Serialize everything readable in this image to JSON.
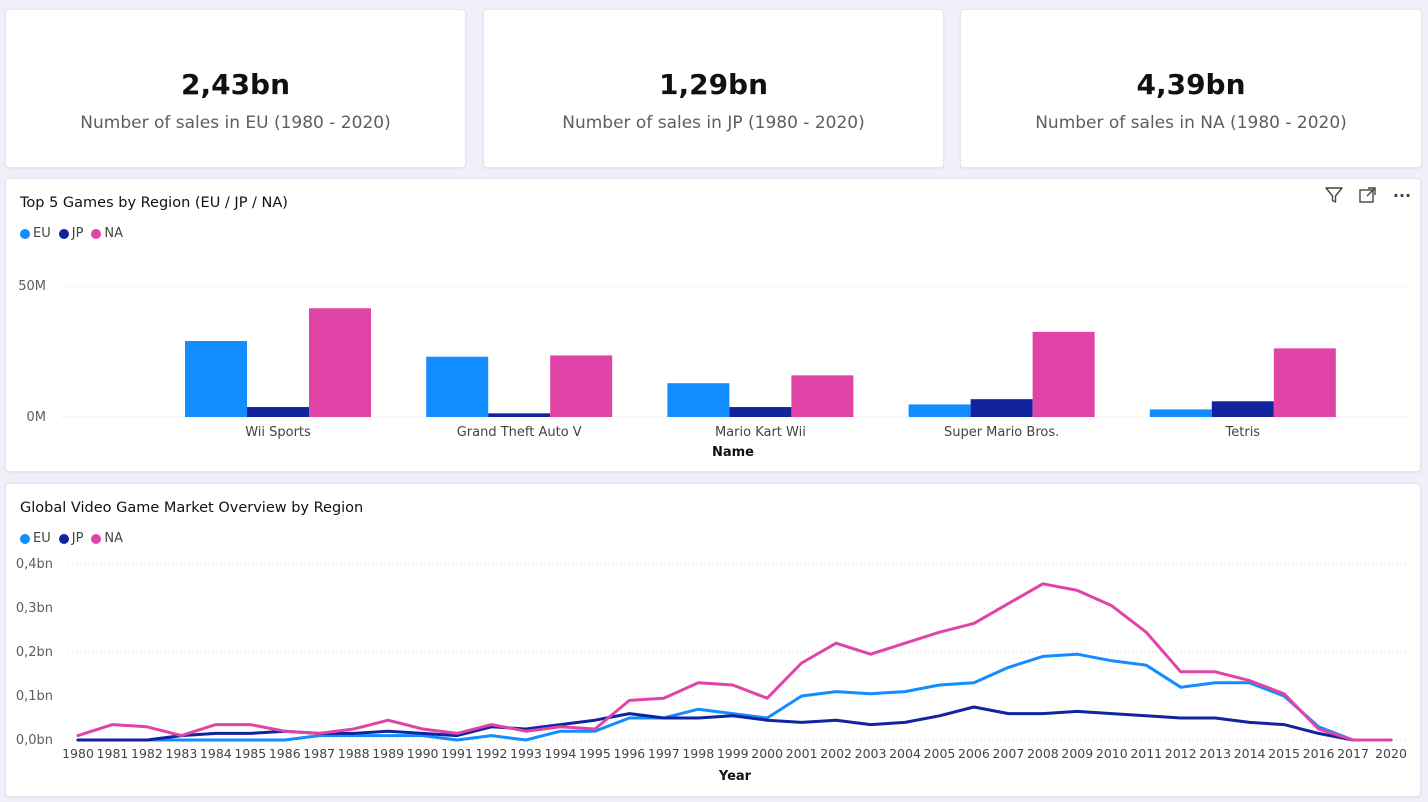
{
  "kpis": [
    {
      "value": "2,43bn",
      "label": "Number of sales in EU (1980 - 2020)"
    },
    {
      "value": "1,29bn",
      "label": "Number of sales in JP (1980 - 2020)"
    },
    {
      "value": "4,39bn",
      "label": "Number of sales in NA (1980 - 2020)"
    }
  ],
  "colors": {
    "EU": "#118dff",
    "JP": "#12239e",
    "NA": "#e044a7"
  },
  "toolbar": {
    "icons": [
      "filter-icon",
      "focus-mode-icon",
      "more-options-icon"
    ],
    "more_label": "···"
  },
  "chart_data": [
    {
      "type": "bar",
      "title": "Top 5 Games by Region (EU / JP / NA)",
      "xlabel": "Name",
      "ylabel": "",
      "categories": [
        "Wii Sports",
        "Grand Theft Auto V",
        "Mario Kart Wii",
        "Super Mario Bros.",
        "Tetris"
      ],
      "series": [
        {
          "name": "EU",
          "values": [
            29.0,
            23.0,
            12.9,
            4.8,
            2.9
          ]
        },
        {
          "name": "JP",
          "values": [
            3.8,
            1.4,
            3.8,
            6.8,
            6.0
          ]
        },
        {
          "name": "NA",
          "values": [
            41.5,
            23.5,
            15.9,
            32.5,
            26.2
          ]
        }
      ],
      "ylim": [
        0,
        50
      ],
      "yticks": [
        "0M",
        "50M"
      ],
      "legend_position": "top-left",
      "grid": true
    },
    {
      "type": "line",
      "title": "Global Video Game Market Overview by Region",
      "xlabel": "Year",
      "ylabel": "",
      "x": [
        "1980",
        "1981",
        "1982",
        "1983",
        "1984",
        "1985",
        "1986",
        "1987",
        "1988",
        "1989",
        "1990",
        "1991",
        "1992",
        "1993",
        "1994",
        "1995",
        "1996",
        "1997",
        "1998",
        "1999",
        "2000",
        "2001",
        "2002",
        "2003",
        "2004",
        "2005",
        "2006",
        "2007",
        "2008",
        "2009",
        "2010",
        "2011",
        "2012",
        "2013",
        "2014",
        "2015",
        "2016",
        "2017",
        "2020"
      ],
      "series": [
        {
          "name": "EU",
          "values": [
            0.0,
            0.0,
            0.0,
            0.0,
            0.0,
            0.0,
            0.0,
            0.01,
            0.01,
            0.01,
            0.01,
            0.0,
            0.01,
            0.0,
            0.02,
            0.02,
            0.05,
            0.05,
            0.07,
            0.06,
            0.05,
            0.1,
            0.11,
            0.105,
            0.11,
            0.125,
            0.13,
            0.165,
            0.19,
            0.195,
            0.18,
            0.17,
            0.12,
            0.13,
            0.13,
            0.1,
            0.03,
            0.0,
            0.0
          ]
        },
        {
          "name": "JP",
          "values": [
            0.0,
            0.0,
            0.0,
            0.01,
            0.015,
            0.015,
            0.02,
            0.015,
            0.015,
            0.02,
            0.015,
            0.01,
            0.03,
            0.025,
            0.035,
            0.045,
            0.06,
            0.05,
            0.05,
            0.055,
            0.045,
            0.04,
            0.045,
            0.035,
            0.04,
            0.055,
            0.075,
            0.06,
            0.06,
            0.065,
            0.06,
            0.055,
            0.05,
            0.05,
            0.04,
            0.035,
            0.015,
            0.0,
            0.0
          ]
        },
        {
          "name": "NA",
          "values": [
            0.01,
            0.035,
            0.03,
            0.01,
            0.035,
            0.035,
            0.02,
            0.015,
            0.025,
            0.045,
            0.025,
            0.015,
            0.035,
            0.02,
            0.03,
            0.025,
            0.09,
            0.095,
            0.13,
            0.125,
            0.095,
            0.175,
            0.22,
            0.195,
            0.22,
            0.245,
            0.265,
            0.31,
            0.355,
            0.34,
            0.305,
            0.245,
            0.155,
            0.155,
            0.135,
            0.105,
            0.025,
            0.0,
            0.0
          ]
        }
      ],
      "ylim": [
        0,
        0.4
      ],
      "yticks": [
        "0,0bn",
        "0,1bn",
        "0,2bn",
        "0,3bn",
        "0,4bn"
      ],
      "legend_position": "top-left",
      "grid": true
    }
  ]
}
